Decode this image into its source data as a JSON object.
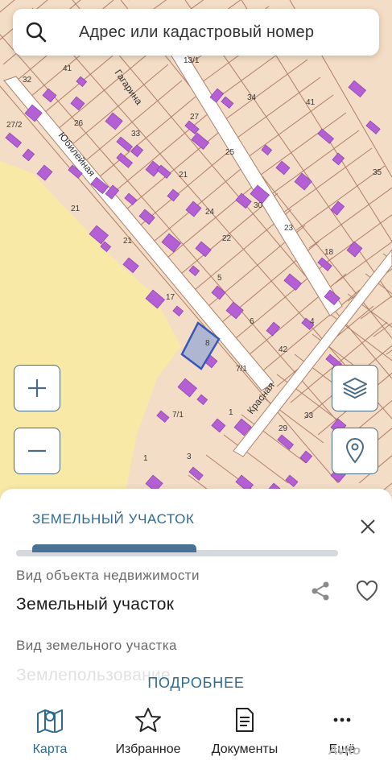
{
  "search": {
    "placeholder": "Адрес или кадастровый номер",
    "icon": "search-icon"
  },
  "map": {
    "streets": [
      "Гагарина",
      "Юбилейная",
      "Красная"
    ],
    "lot_numbers": [
      "41",
      "32",
      "27/2",
      "26",
      "21",
      "33",
      "21",
      "25",
      "24",
      "27",
      "30",
      "23",
      "22",
      "18",
      "21",
      "17",
      "5",
      "6",
      "8",
      "4",
      "7/1",
      "7/1",
      "1",
      "3",
      "1",
      "33",
      "29",
      "13/1",
      "35",
      "41",
      "34",
      "42",
      "35",
      "25"
    ],
    "selected_parcel": "7/1",
    "colors": {
      "background": "#f3ddc6",
      "parcel_lines": "#b07e68",
      "buildings": "#b45fd3",
      "road": "#ffffff",
      "field": "#f8e9a7",
      "selected": "#aeb6d1"
    }
  },
  "controls": {
    "zoom_in": "+",
    "zoom_out": "−",
    "layers_icon": "layers-icon",
    "location_icon": "location-pin-icon"
  },
  "sheet": {
    "tab": "ЗЕМЕЛЬНЫЙ УЧАСТОК",
    "field1_label": "Вид объекта недвижимости",
    "field1_value": "Земельный участок",
    "field2_label": "Вид земельного участка",
    "field2_value": "Землепользование",
    "more_button": "ПОДРОБНЕЕ"
  },
  "nav": {
    "items": [
      {
        "label": "Карта",
        "icon": "map-icon",
        "active": true
      },
      {
        "label": "Избранное",
        "icon": "star-icon",
        "active": false
      },
      {
        "label": "Документы",
        "icon": "document-icon",
        "active": false
      },
      {
        "label": "Ещё",
        "icon": "more-dots-icon",
        "active": false
      }
    ]
  },
  "watermark": "Avito",
  "accent_color": "#2f6a8f"
}
